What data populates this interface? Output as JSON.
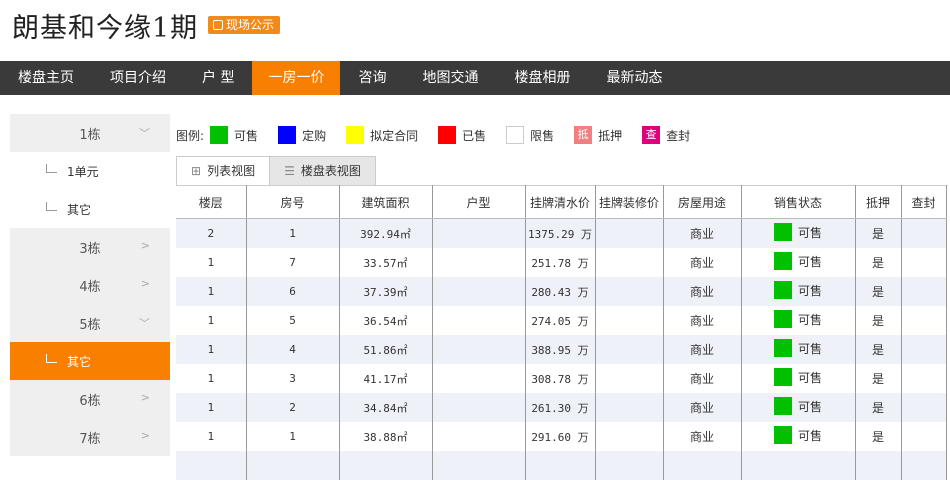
{
  "header": {
    "title": "朗基和今缘1期",
    "badge": "现场公示"
  },
  "nav": [
    {
      "label": "楼盘主页",
      "active": false
    },
    {
      "label": "项目介绍",
      "active": false
    },
    {
      "label": "户 型",
      "active": false
    },
    {
      "label": "一房一价",
      "active": true
    },
    {
      "label": "咨询",
      "active": false
    },
    {
      "label": "地图交通",
      "active": false
    },
    {
      "label": "楼盘相册",
      "active": false
    },
    {
      "label": "最新动态",
      "active": false
    }
  ],
  "sidebar": [
    {
      "type": "building",
      "label": "1栋",
      "chev": "﹀"
    },
    {
      "type": "unit",
      "label": "1单元",
      "active": false
    },
    {
      "type": "unit",
      "label": "其它",
      "active": false
    },
    {
      "type": "building",
      "label": "3栋",
      "chev": ">"
    },
    {
      "type": "building",
      "label": "4栋",
      "chev": ">"
    },
    {
      "type": "building",
      "label": "5栋",
      "chev": "﹀"
    },
    {
      "type": "unit",
      "label": "其它",
      "active": true
    },
    {
      "type": "building",
      "label": "6栋",
      "chev": ">"
    },
    {
      "type": "building",
      "label": "7栋",
      "chev": ">"
    }
  ],
  "legend": {
    "label": "图例:",
    "items": [
      {
        "label": "可售",
        "color": "#00c000",
        "text": ""
      },
      {
        "label": "定购",
        "color": "#0000ff",
        "text": ""
      },
      {
        "label": "拟定合同",
        "color": "#ffff00",
        "text": ""
      },
      {
        "label": "已售",
        "color": "#ff0000",
        "text": ""
      },
      {
        "label": "限售",
        "color": "#ffffff",
        "text": ""
      },
      {
        "label": "抵押",
        "color": "#f08080",
        "text": "抵"
      },
      {
        "label": "查封",
        "color": "#e0007a",
        "text": "查"
      }
    ]
  },
  "tabs": [
    {
      "label": "列表视图",
      "selected": false,
      "icon": "grid-icon"
    },
    {
      "label": "楼盘表视图",
      "selected": true,
      "icon": "list-icon"
    }
  ],
  "table": {
    "columns": [
      "楼层",
      "房号",
      "建筑面积",
      "户型",
      "挂牌清水价",
      "挂牌装修价",
      "房屋用途",
      "销售状态",
      "抵押",
      "查封"
    ],
    "rows": [
      {
        "floor": "2",
        "room": "1",
        "area": "392.94㎡",
        "type": "",
        "price": "1375.29 万",
        "deco": "",
        "use": "商业",
        "status": "可售",
        "mortgage": "是",
        "seal": ""
      },
      {
        "floor": "1",
        "room": "7",
        "area": "33.57㎡",
        "type": "",
        "price": "251.78 万",
        "deco": "",
        "use": "商业",
        "status": "可售",
        "mortgage": "是",
        "seal": ""
      },
      {
        "floor": "1",
        "room": "6",
        "area": "37.39㎡",
        "type": "",
        "price": "280.43 万",
        "deco": "",
        "use": "商业",
        "status": "可售",
        "mortgage": "是",
        "seal": ""
      },
      {
        "floor": "1",
        "room": "5",
        "area": "36.54㎡",
        "type": "",
        "price": "274.05 万",
        "deco": "",
        "use": "商业",
        "status": "可售",
        "mortgage": "是",
        "seal": ""
      },
      {
        "floor": "1",
        "room": "4",
        "area": "51.86㎡",
        "type": "",
        "price": "388.95 万",
        "deco": "",
        "use": "商业",
        "status": "可售",
        "mortgage": "是",
        "seal": ""
      },
      {
        "floor": "1",
        "room": "3",
        "area": "41.17㎡",
        "type": "",
        "price": "308.78 万",
        "deco": "",
        "use": "商业",
        "status": "可售",
        "mortgage": "是",
        "seal": ""
      },
      {
        "floor": "1",
        "room": "2",
        "area": "34.84㎡",
        "type": "",
        "price": "261.30 万",
        "deco": "",
        "use": "商业",
        "status": "可售",
        "mortgage": "是",
        "seal": ""
      },
      {
        "floor": "1",
        "room": "1",
        "area": "38.88㎡",
        "type": "",
        "price": "291.60 万",
        "deco": "",
        "use": "商业",
        "status": "可售",
        "mortgage": "是",
        "seal": ""
      },
      {
        "floor": "",
        "room": "",
        "area": "",
        "type": "",
        "price": "",
        "deco": "",
        "use": "",
        "status": "",
        "mortgage": "",
        "seal": ""
      }
    ]
  }
}
